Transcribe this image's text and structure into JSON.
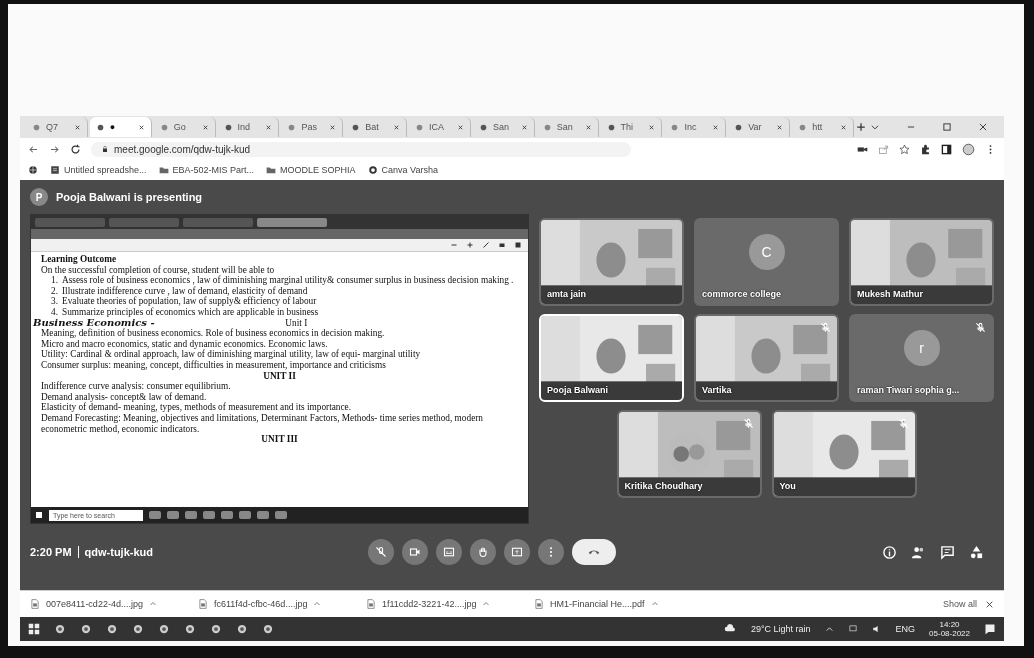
{
  "browser": {
    "tabs": [
      {
        "label": "Q7",
        "selected": false
      },
      {
        "label": "●",
        "selected": true
      },
      {
        "label": "Go",
        "selected": false
      },
      {
        "label": "Ind",
        "selected": false
      },
      {
        "label": "Pas",
        "selected": false
      },
      {
        "label": "Bat",
        "selected": false
      },
      {
        "label": "ICA",
        "selected": false
      },
      {
        "label": "San",
        "selected": false
      },
      {
        "label": "San",
        "selected": false
      },
      {
        "label": "Thi",
        "selected": false
      },
      {
        "label": "Inc",
        "selected": false
      },
      {
        "label": "Var",
        "selected": false
      },
      {
        "label": "htt",
        "selected": false
      }
    ],
    "address": "meet.google.com/qdw-tujk-kud",
    "bookmarks": [
      "Untitled spreadshe...",
      "EBA-502-MIS Part...",
      "MOODLE SOPHIA",
      "Canva Varsha"
    ]
  },
  "meet": {
    "presenting_banner": "Pooja Balwani is presenting",
    "avatar_letter": "P",
    "presentation": {
      "document_tabs": [
        {
          "selected": false
        },
        {
          "selected": false
        },
        {
          "selected": false
        },
        {
          "selected": true
        }
      ],
      "heading": "Learning Outcome",
      "intro": "On the successful completion of course, student will be able to",
      "outcomes": [
        {
          "number": "1.",
          "text": "Assess role of business economics , law of diminishing marginal utility& consumer surplus in business decision making ."
        },
        {
          "number": "2.",
          "text": "Illustrate indifference curve , law of demand, elasticity of demand"
        },
        {
          "number": "3.",
          "text": "Evaluate theories of population, law of supply& efficiency of labour"
        },
        {
          "number": "4.",
          "text": "Summarize principles of economics which are applicable in business"
        }
      ],
      "annotation": "Business Economics -",
      "sections": [
        {
          "title": "Unit I",
          "lines": [
            "Meaning, definition of business economics. Role of business economics in decision making.",
            "Micro and macro economics, static and dynamic economics. Economic laws.",
            "Utility: Cardinal & ordinal approach, law of diminishing marginal utility, law of equi- marginal utility",
            "Consumer surplus: meaning, concept, difficulties in measurement, importance and criticisms"
          ]
        },
        {
          "title": "UNIT II",
          "lines": [
            "Indifference curve analysis: consumer equilibrium.",
            "Demand analysis- concept& law of demand.",
            "Elasticity of demand- meaning, types, methods of measurement and its importance.",
            "Demand Forecasting: Meaning, objectives and limitations, Determinant Factors, Methods- time series method, modern econometric method, economic indicators."
          ]
        },
        {
          "title": "UNIT III"
        }
      ],
      "taskbar_search": "Type here to search"
    },
    "tiles": [
      {
        "name": "amta jain",
        "kind": "video",
        "muted": false,
        "speaking": false
      },
      {
        "name": "commorce college",
        "kind": "avatar",
        "letter": "C",
        "muted": false,
        "speaking": false
      },
      {
        "name": "Mukesh Mathur",
        "kind": "video",
        "muted": false,
        "speaking": false
      },
      {
        "name": "Pooja Balwani",
        "kind": "video",
        "muted": false,
        "speaking": true
      },
      {
        "name": "Vartika",
        "kind": "video",
        "muted": true,
        "speaking": false
      },
      {
        "name": "raman Tiwari sophia g...",
        "kind": "avatar",
        "letter": "r",
        "muted": true,
        "speaking": false
      },
      {
        "name": "Kritika Choudhary",
        "muted": true,
        "speaking": false
      },
      {
        "name": "You",
        "kind": "video",
        "muted": true,
        "speaking": false
      }
    ],
    "time": "2:20 PM",
    "meeting_code": "qdw-tujk-kud"
  },
  "downloads": {
    "files": [
      "007e8411-cd22-4d....jpg",
      "fc611f4d-cfbc-46d....jpg",
      "1f11cdd2-3221-42....jpg",
      "HM1-Financial He....pdf"
    ],
    "show_all": "Show all"
  },
  "taskbar": {
    "weather": "29°C Light rain",
    "language": "ENG",
    "time": "14:20",
    "date": "05-08-2022"
  }
}
